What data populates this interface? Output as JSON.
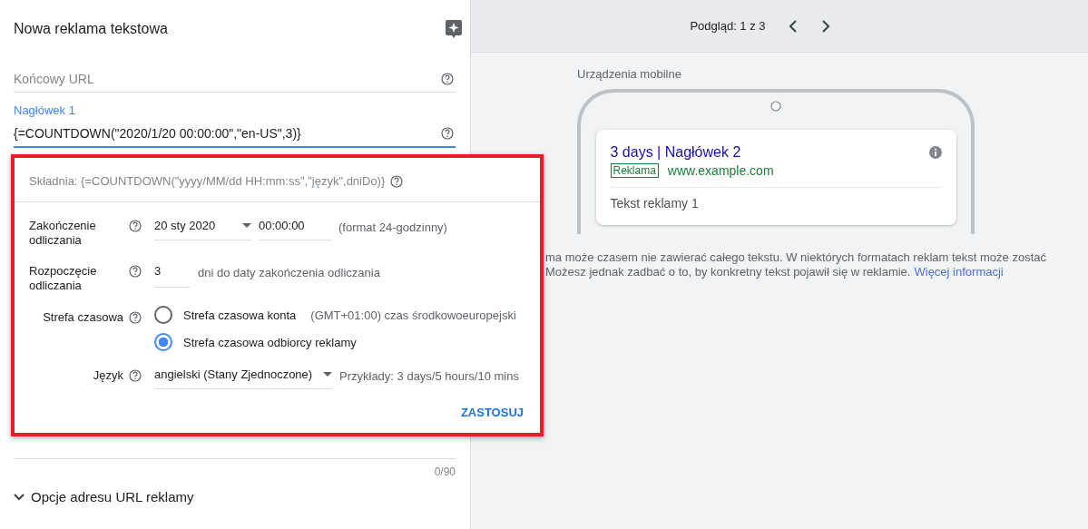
{
  "editor": {
    "title": "Nowa reklama tekstowa",
    "fields": [
      {
        "placeholder": "Końcowy URL",
        "focused": false
      },
      {
        "label": "Nagłówek 1",
        "value": "{=COUNTDOWN(\"2020/1/20 00:00:00\",\"en-US\",3)}",
        "focused": true
      }
    ],
    "counter": "0/90",
    "expander": {
      "label": "Opcje adresu URL reklamy",
      "expanded": false
    }
  },
  "countdown_popup": {
    "syntax": "Składnia: {=COUNTDOWN(\"yyyy/MM/dd HH:mm:ss\",\"język\",dniDo)}",
    "end": {
      "label": "Zakończenie odliczania",
      "date": "20 sty 2020",
      "time": "00:00:00",
      "note": "(format 24-godzinny)"
    },
    "start": {
      "label": "Rozpoczęcie odliczania",
      "days": "3",
      "note": "dni do daty zakończenia odliczania"
    },
    "timezone": {
      "label": "Strefa czasowa",
      "options": [
        {
          "label": "Strefa czasowa konta",
          "detail": "(GMT+01:00) czas środkowoeuropejski",
          "selected": false
        },
        {
          "label": "Strefa czasowa odbiorcy reklamy",
          "selected": true
        }
      ]
    },
    "language": {
      "label": "Język",
      "value": "angielski (Stany Zjednoczone)",
      "examples": "Przykłady: 3 days/5 hours/10 mins"
    },
    "apply": "ZASTOSUJ"
  },
  "preview": {
    "pager": "Podgląd: 1 z 3",
    "device": "Urządzenia mobilne",
    "ad": {
      "headline": "3 days | Nagłówek 2",
      "badge": "Reklama",
      "url": "www.example.com",
      "description": "Tekst reklamy 1"
    },
    "disclaimer_lines": [
      "ma może czasem nie zawierać całego tekstu. W niektórych formatach reklam tekst może zostać",
      "Możesz jednak zadbać o to, by konkretny tekst pojawił się w reklamie."
    ],
    "link": "Więcej informacji"
  }
}
